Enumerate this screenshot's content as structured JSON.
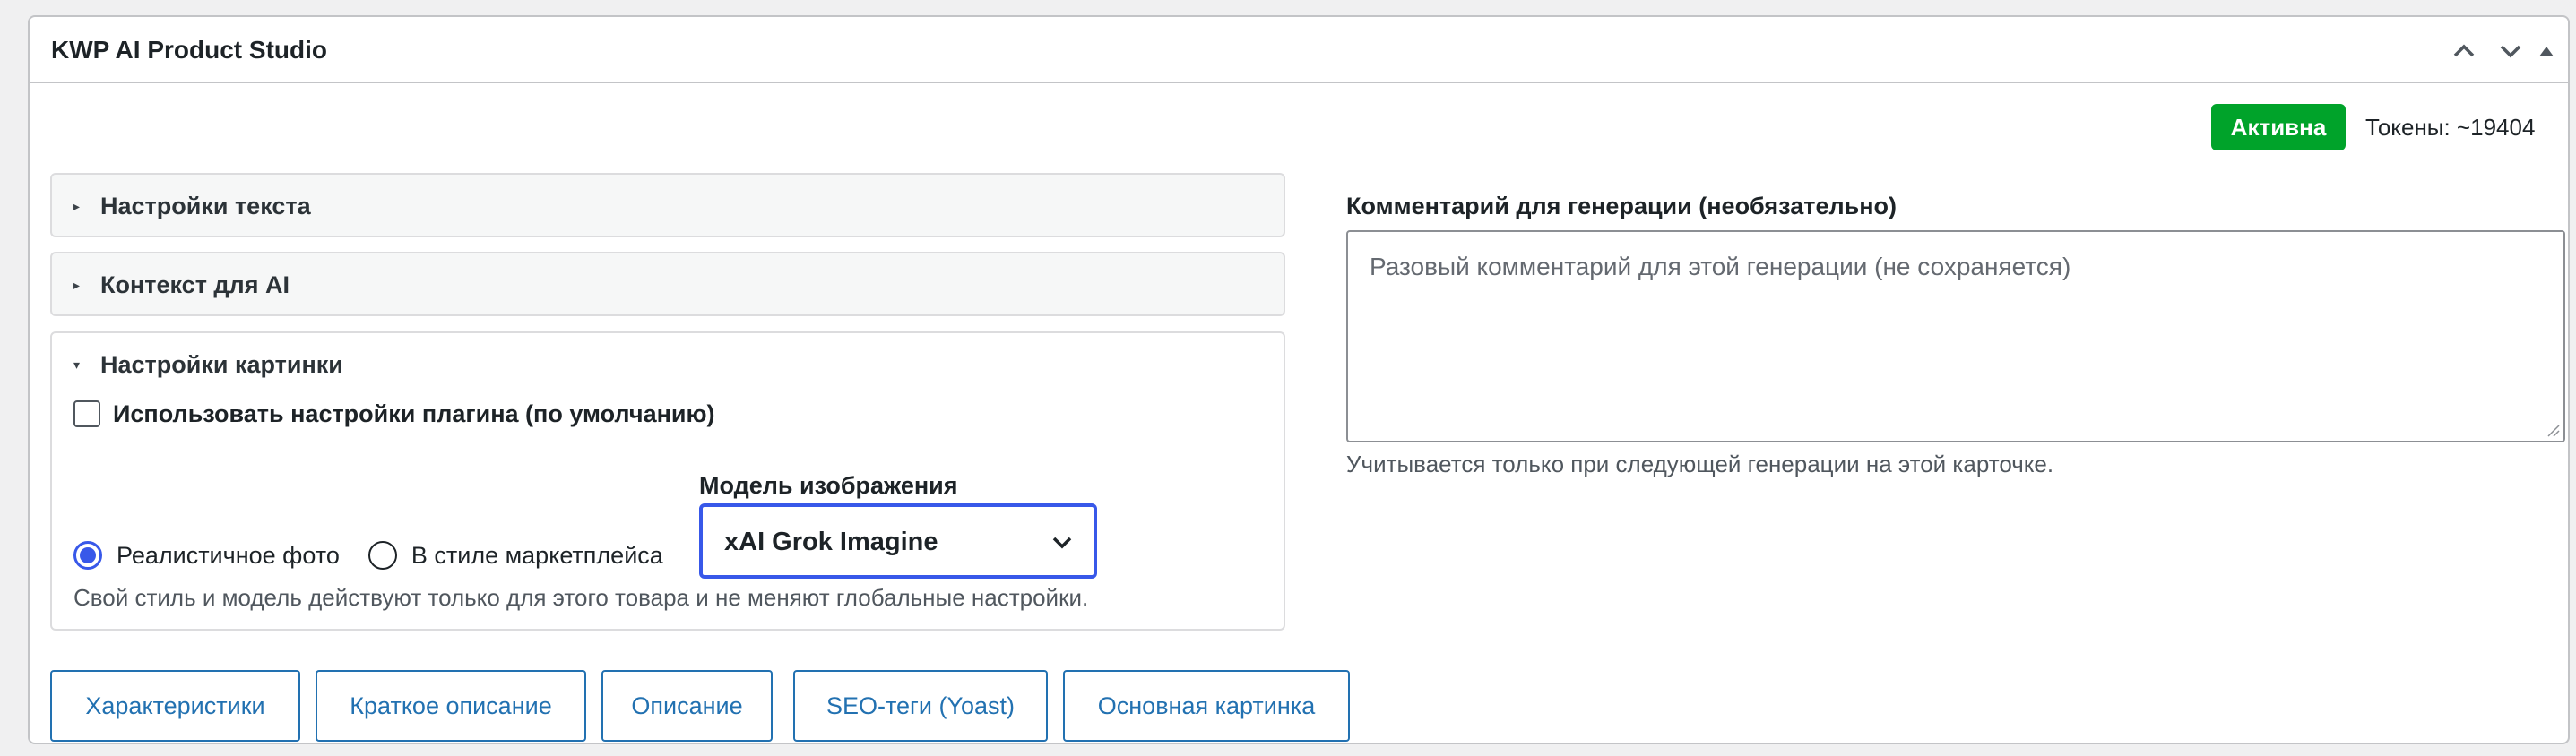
{
  "header": {
    "title": "KWP AI Product Studio",
    "icons": [
      "chevron-up-icon",
      "chevron-down-icon",
      "triangle-up-icon"
    ]
  },
  "status": {
    "badge": "Активна",
    "tokens": "Токены: ~19404"
  },
  "sections": {
    "text_settings": "Настройки текста",
    "ai_context": "Контекст для AI",
    "image_settings": {
      "title": "Настройки картинки",
      "use_plugin_defaults": {
        "label": "Использовать настройки плагина (по умолчанию)",
        "checked": false
      },
      "style_options": [
        {
          "label": "Реалистичное фото",
          "checked": true
        },
        {
          "label": "В стиле маркетплейса",
          "checked": false
        }
      ],
      "model_label": "Модель изображения",
      "model_value": "xAI Grok Imagine",
      "note": "Свой стиль и модель действуют только для этого товара и не меняют глобальные настройки."
    }
  },
  "comment": {
    "label": "Комментарий для генерации (необязательно)",
    "placeholder": "Разовый комментарий для этой генерации (не сохраняется)",
    "value": "",
    "help": "Учитывается только при следующей генерации на этой карточке."
  },
  "actions": [
    "Характеристики",
    "Краткое описание",
    "Описание",
    "SEO-теги (Yoast)",
    "Основная картинка"
  ],
  "colors": {
    "accent": "#3858e9",
    "button_link": "#2271b1",
    "status_active": "#00a32a"
  }
}
